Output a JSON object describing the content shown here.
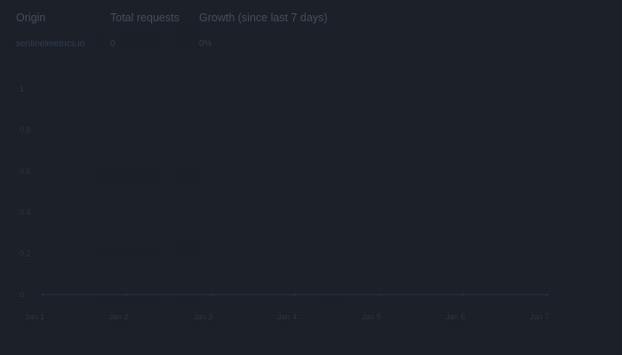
{
  "table": {
    "headers": {
      "origin": "Origin",
      "total_requests": "Total requests",
      "growth": "Growth (since last 7 days)"
    },
    "rows": [
      {
        "origin": "sentinelmetrics.io",
        "total_requests": "0",
        "growth": "0%"
      }
    ]
  },
  "chart_data": {
    "type": "line",
    "x": [
      "Jan 1",
      "Jan 2",
      "Jan 3",
      "Jan 4",
      "Jan 5",
      "Jan 6",
      "Jan 7"
    ],
    "y_ticks": [
      "1",
      "0.8",
      "0.6",
      "0.4",
      "0.2",
      "0"
    ],
    "ylim": [
      0,
      1
    ],
    "series": [
      {
        "values": [
          0,
          0,
          0,
          0,
          0,
          0,
          0
        ]
      }
    ],
    "grid": false,
    "colors": {
      "line": "#2a3140"
    }
  },
  "colors": {
    "background": "#1b1f27",
    "header_text": "#474e59",
    "link_text": "#2e3d5a",
    "muted_text": "#353b45"
  }
}
